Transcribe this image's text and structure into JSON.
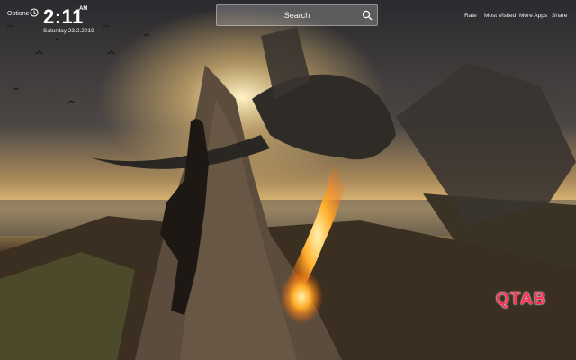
{
  "header": {
    "options_label": "Options",
    "time": "2:11",
    "ampm": "AM",
    "date": "Saturday  23.2.2019"
  },
  "search": {
    "placeholder": "Search"
  },
  "nav": [
    {
      "label": "Rate"
    },
    {
      "label": "Most Visited"
    },
    {
      "label": "More Apps"
    },
    {
      "label": "Share"
    }
  ],
  "brand": {
    "label": "QTAB",
    "color": "#ff2d55"
  },
  "icons": {
    "clock": "clock-icon",
    "search": "search-icon"
  }
}
